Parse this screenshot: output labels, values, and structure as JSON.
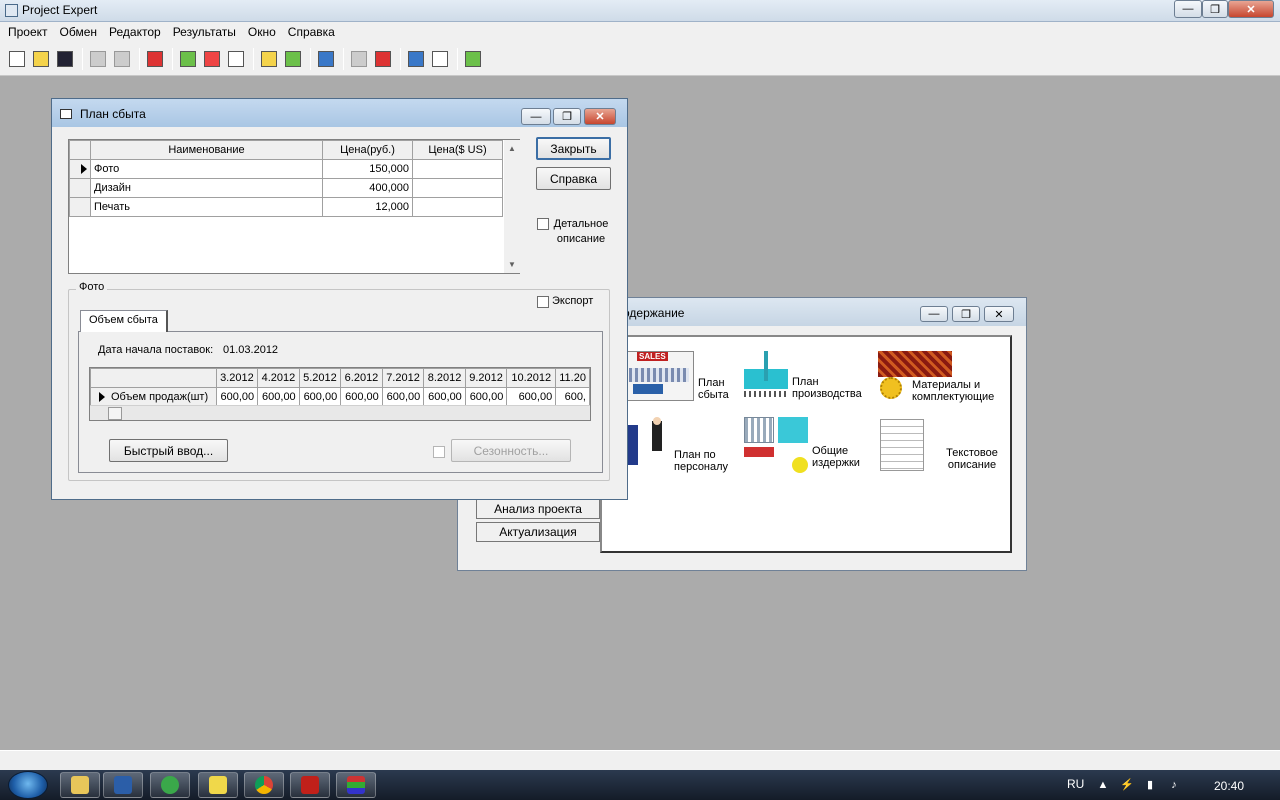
{
  "app": {
    "title": "Project Expert",
    "min_glyph": "—",
    "max_glyph": "❐",
    "close_glyph": "✕"
  },
  "menu": [
    "Проект",
    "Обмен",
    "Редактор",
    "Результаты",
    "Окно",
    "Справка"
  ],
  "content_window": {
    "title": "одержание",
    "side_buttons": [
      "Анализ проекта",
      "Актуализация"
    ],
    "modules": {
      "sales_plan": "План сбыта",
      "production_plan": "План производства",
      "materials": "Материалы и комплектующие",
      "personnel_plan": "План по персоналу",
      "overheads": "Общие издержки",
      "text_description": "Текстовое описание",
      "sales_badge": "SALES"
    }
  },
  "sales_window": {
    "title": "План сбыта",
    "columns": [
      "Наименование",
      "Цена(руб.)",
      "Цена($ US)"
    ],
    "rows": [
      {
        "name": "Фото",
        "price_rub": "150,000",
        "price_usd": ""
      },
      {
        "name": "Дизайн",
        "price_rub": "400,000",
        "price_usd": ""
      },
      {
        "name": "Печать",
        "price_rub": "12,000",
        "price_usd": ""
      }
    ],
    "close_button": "Закрыть",
    "help_button": "Справка",
    "detail_checkbox": "Детальное описание",
    "group_label": "Фото",
    "export_checkbox": "Экспорт",
    "tab_label": "Объем сбыта",
    "start_date_label": "Дата начала поставок:",
    "start_date_value": "01.03.2012",
    "period_headers": [
      "3.2012",
      "4.2012",
      "5.2012",
      "6.2012",
      "7.2012",
      "8.2012",
      "9.2012",
      "10.2012",
      "11.20"
    ],
    "volume_row_label": "Объем продаж(шт)",
    "volume_values": [
      "600,00",
      "600,00",
      "600,00",
      "600,00",
      "600,00",
      "600,00",
      "600,00",
      "600,00",
      "600,"
    ],
    "quick_input_button": "Быстрый ввод...",
    "seasonality_button": "Сезонность..."
  },
  "taskbar": {
    "lang": "RU",
    "clock": "20:40"
  }
}
